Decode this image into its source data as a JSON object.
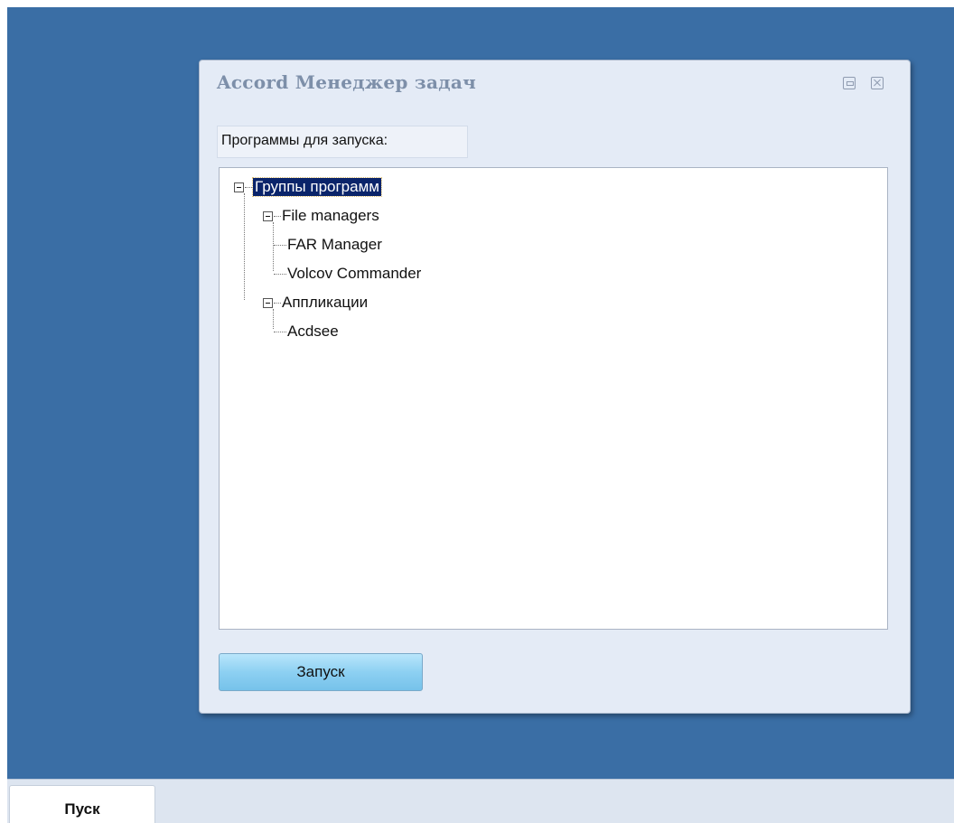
{
  "window": {
    "title": "Accord Менеджер задач",
    "restore_icon": "restore-icon",
    "close_icon": "close-icon"
  },
  "programs_label": "Программы для запуска:",
  "tree": {
    "root": {
      "label": "Группы программ",
      "expanded": true,
      "selected": true
    },
    "groups": [
      {
        "label": "File managers",
        "expanded": true,
        "items": [
          "FAR Manager",
          "Volcov Commander"
        ]
      },
      {
        "label": "Аппликации",
        "expanded": true,
        "items": [
          "Acdsee"
        ]
      }
    ]
  },
  "launch_button": "Запуск",
  "taskbar": {
    "start_label": "Пуск"
  },
  "colors": {
    "desktop": "#3a6ea5",
    "selection": "#0a246a"
  }
}
